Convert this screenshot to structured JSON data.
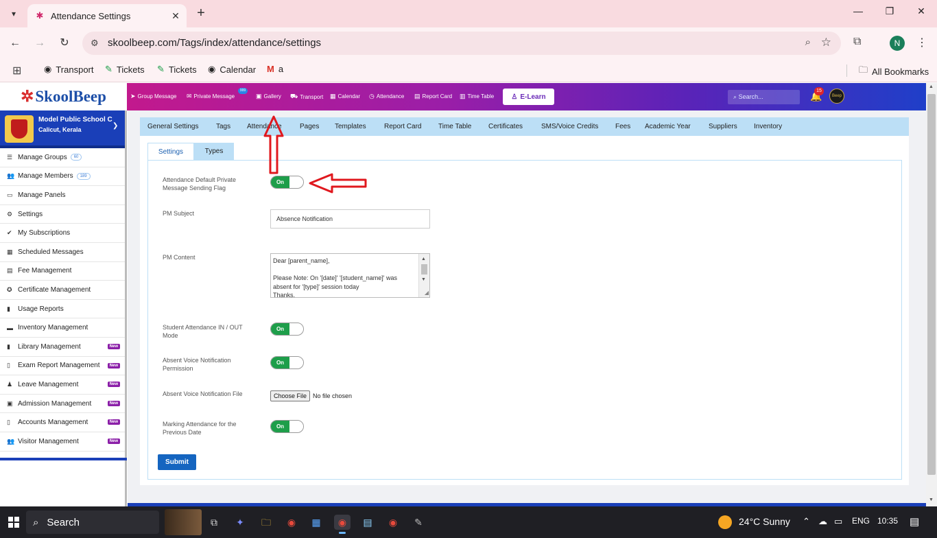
{
  "browser": {
    "tab_title": "Attendance Settings",
    "url": "skoolbeep.com/Tags/index/attendance/settings",
    "bookmarks": [
      "Transport",
      "Tickets",
      "Tickets",
      "Calendar",
      "a"
    ],
    "all_bookmarks": "All Bookmarks",
    "profile_initial": "N"
  },
  "app": {
    "logo": "SkoolBeep",
    "top_nav": [
      "Group Message",
      "Private Message",
      "Gallery",
      "Transport",
      "Calendar",
      "Attendance",
      "Report Card",
      "Time Table"
    ],
    "private_msg_badge": "999",
    "elearn_label": "E-Learn",
    "search_placeholder": "Search...",
    "notification_count": "15",
    "avatar_text": "Beep"
  },
  "sidebar": {
    "school_name": "Model Public School C",
    "school_location": "Calicut, Kerala",
    "items": [
      {
        "label": "Manage Groups",
        "count": "60",
        "new": ""
      },
      {
        "label": "Manage Members",
        "count": "189",
        "new": ""
      },
      {
        "label": "Manage Panels",
        "count": "",
        "new": ""
      },
      {
        "label": "Settings",
        "count": "",
        "new": ""
      },
      {
        "label": "My Subscriptions",
        "count": "",
        "new": ""
      },
      {
        "label": "Scheduled Messages",
        "count": "",
        "new": ""
      },
      {
        "label": "Fee Management",
        "count": "",
        "new": ""
      },
      {
        "label": "Certificate Management",
        "count": "",
        "new": ""
      },
      {
        "label": "Usage Reports",
        "count": "",
        "new": ""
      },
      {
        "label": "Inventory Management",
        "count": "",
        "new": ""
      },
      {
        "label": "Library Management",
        "count": "",
        "new": "New"
      },
      {
        "label": "Exam Report Management",
        "count": "",
        "new": "New"
      },
      {
        "label": "Leave Management",
        "count": "",
        "new": "New"
      },
      {
        "label": "Admission Management",
        "count": "",
        "new": "New"
      },
      {
        "label": "Accounts Management",
        "count": "",
        "new": "New"
      },
      {
        "label": "Visitor Management",
        "count": "",
        "new": "New"
      }
    ]
  },
  "subnav": [
    "General Settings",
    "Tags",
    "Attendance",
    "Pages",
    "Templates",
    "Report Card",
    "Time Table",
    "Certificates",
    "SMS/Voice Credits",
    "Fees",
    "Academic Year",
    "Suppliers",
    "Inventory"
  ],
  "card_tabs": {
    "active": "Settings",
    "other": "Types"
  },
  "form": {
    "pm_flag_label": "Attendance Default Private Message Sending Flag",
    "pm_flag_state": "On",
    "pm_subject_label": "PM Subject",
    "pm_subject_value": "Absence Notification",
    "pm_content_label": "PM Content",
    "pm_content_lines": [
      "Dear [parent_name],",
      "",
      "Please Note: On '[date]' '[student_name]' was absent for '[type]' session today",
      "Thanks,"
    ],
    "inout_label": "Student Attendance IN / OUT Mode",
    "inout_state": "On",
    "voice_perm_label": "Absent Voice Notification Permission",
    "voice_perm_state": "On",
    "voice_file_label": "Absent Voice Notification File",
    "choose_file": "Choose File",
    "no_file": "No file chosen",
    "prev_date_label": "Marking Attendance for the Previous Date",
    "prev_date_state": "On",
    "submit_label": "Submit"
  },
  "taskbar": {
    "search": "Search",
    "weather": "24°C  Sunny",
    "lang": "ENG",
    "time": "10:35"
  },
  "colors": {
    "brand_blue": "#1a3fb8",
    "toggle_green": "#1e9e4a",
    "subnav_bg": "#bcdff6",
    "annotation_red": "#e0181e",
    "submit_blue": "#1565c0"
  }
}
